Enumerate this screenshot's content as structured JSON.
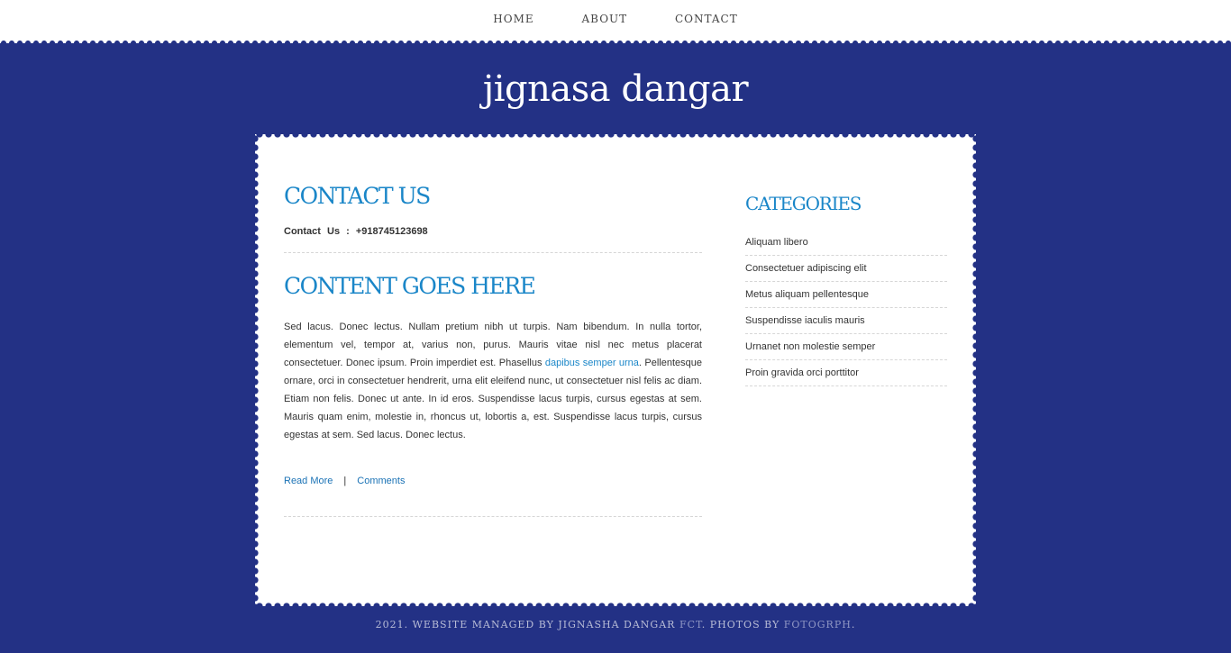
{
  "nav": {
    "items": [
      "HOME",
      "ABOUT",
      "CONTACT"
    ]
  },
  "site": {
    "title": "jignasa dangar"
  },
  "main": {
    "contact_heading": "CONTACT US",
    "contact_line": "Contact Us : +918745123698",
    "content_heading": "CONTENT GOES HERE",
    "body_part1": "Sed lacus. Donec lectus. Nullam pretium nibh ut turpis. Nam bibendum. In nulla tortor, elementum vel, tempor at, varius non, purus. Mauris vitae nisl nec metus placerat consectetuer. Donec ipsum. Proin imperdiet est. Phasellus ",
    "body_link": "dapibus semper urna",
    "body_part2": ". Pellentesque ornare, orci in consectetuer hendrerit, urna elit eleifend nunc, ut consectetuer nisl felis ac diam. Etiam non felis. Donec ut ante. In id eros. Suspendisse lacus turpis, cursus egestas at sem. Mauris quam enim, molestie in, rhoncus ut, lobortis a, est. Suspendisse lacus turpis, cursus egestas at sem. Sed lacus. Donec lectus.",
    "read_more": "Read More",
    "separator": "|",
    "comments": "Comments"
  },
  "sidebar": {
    "heading": "CATEGORIES",
    "items": [
      "Aliquam libero",
      "Consectetuer adipiscing elit",
      "Metus aliquam pellentesque",
      "Suspendisse iaculis mauris",
      "Urnanet non molestie semper",
      "Proin gravida orci porttitor"
    ]
  },
  "footer": {
    "text1": "2021. WEBSITE MANAGED BY JIGNASHA DANGAR ",
    "link1": "FCT",
    "text2": ". PHOTOS BY ",
    "link2": "FOTOGRPH",
    "text3": "."
  },
  "colors": {
    "background": "#233185",
    "accent": "#1a86c8"
  }
}
